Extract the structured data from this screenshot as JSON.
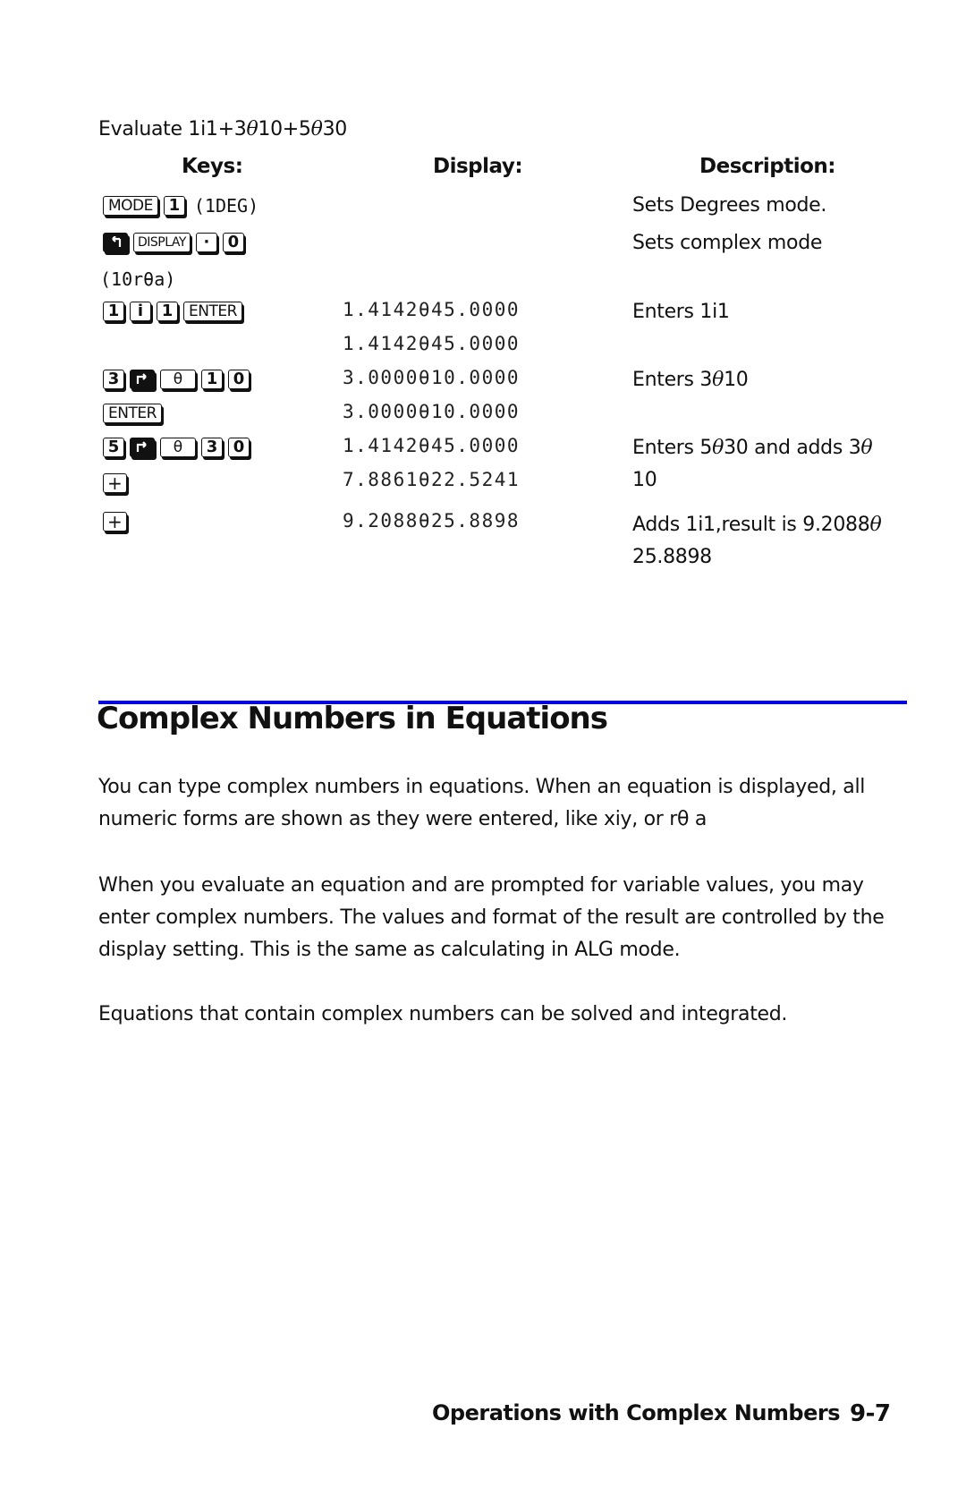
{
  "example": {
    "intro_prefix": "Evaluate 1i1+3",
    "intro_theta1": "θ",
    "intro_mid": "10+5",
    "intro_theta2": "θ",
    "intro_suffix": "30"
  },
  "table": {
    "headers": {
      "keys": "Keys:",
      "display": "Display:",
      "description": "Description:"
    },
    "rows": [
      {
        "keys": [
          "MODE",
          "1"
        ],
        "note": "(1DEG)",
        "display": "",
        "description": "Sets Degrees mode."
      },
      {
        "keys": [
          "shift-left",
          "DISPLAY",
          "·",
          "0"
        ],
        "display": "",
        "description": "Sets complex mode"
      },
      {
        "note": "(10rθa)"
      },
      {
        "keys": [
          "1",
          "i",
          "1",
          "ENTER"
        ],
        "display": "1.4142θ45.0000",
        "description": "Enters 1i1"
      },
      {
        "keys": [],
        "display": "1.4142θ45.0000",
        "description": ""
      },
      {
        "keys": [
          "3",
          "shift-right",
          "θ",
          "1",
          "0"
        ],
        "display": "3.0000θ10.0000",
        "description_prefix": "Enters 3",
        "description_theta": "θ",
        "description_suffix": "10"
      },
      {
        "keys": [
          "ENTER"
        ],
        "display": "3.0000θ10.0000",
        "description": ""
      },
      {
        "keys": [
          "5",
          "shift-right",
          "θ",
          "3",
          "0"
        ],
        "display": "1.4142θ45.0000",
        "description_prefix": "Enters 5",
        "description_theta": "θ",
        "description_mid": "30 and adds 3",
        "description_theta2": "θ",
        "description_line2": "10"
      },
      {
        "keys": [
          "+"
        ],
        "display": "7.8861θ22.5241",
        "description": ""
      },
      {
        "keys": [
          "+"
        ],
        "display": "9.2088θ25.8898",
        "description_prefix": "Adds 1i1,result is 9.2088",
        "description_theta": "θ",
        "description_line2": "25.8898"
      }
    ]
  },
  "section": {
    "rule_color": "#0000ff",
    "heading": "Complex Numbers in Equations",
    "paragraphs": [
      [
        "You can type complex numbers in equations. When an equation is displayed, all",
        "numeric forms are shown as they were entered, like xiy, or rθ a"
      ],
      [
        "When you evaluate an equation and are prompted for variable values, you may",
        "enter complex numbers. The values and format of the result are controlled by the",
        "display setting. This is the same as calculating in ALG mode."
      ],
      [
        "Equations that contain complex numbers can be solved and integrated."
      ]
    ]
  },
  "footer": {
    "chapter_title": "Operations with Complex Numbers",
    "page_number": "9-7"
  }
}
